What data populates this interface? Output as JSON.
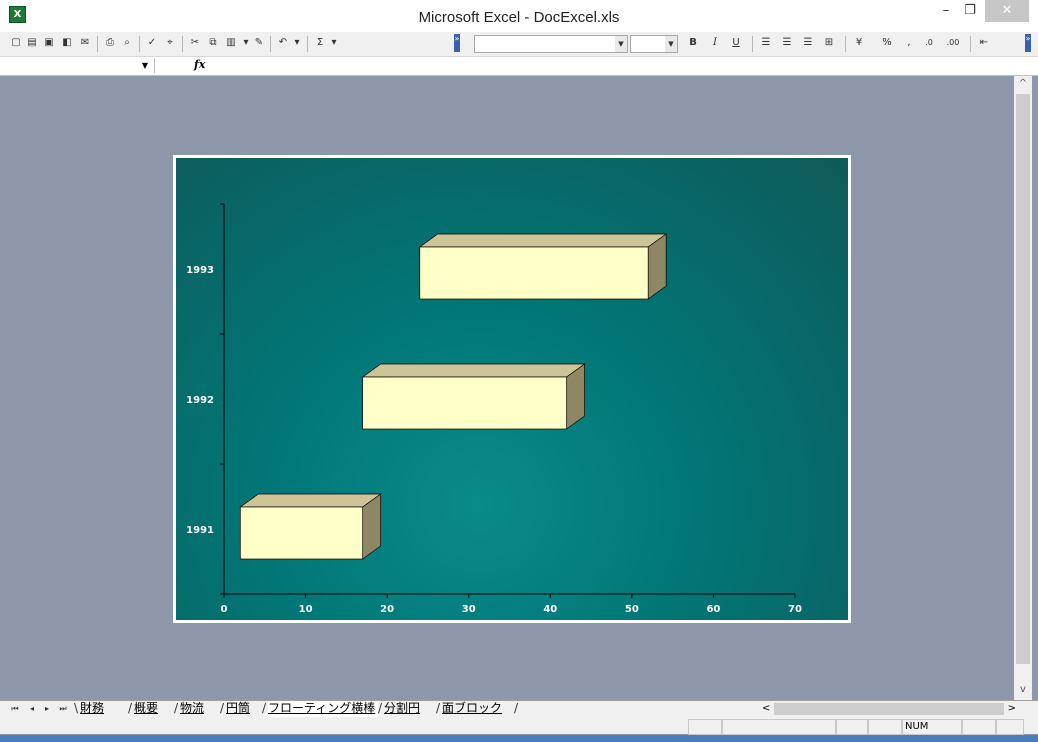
{
  "window": {
    "title": "Microsoft Excel - DocExcel.xls",
    "app_icon": "X"
  },
  "formula_bar": {
    "fx_label": "fx",
    "name_box": "",
    "formula": ""
  },
  "sheets": [
    {
      "label": "財務",
      "active": false
    },
    {
      "label": "概要",
      "active": false
    },
    {
      "label": "物流",
      "active": false
    },
    {
      "label": "円筒",
      "active": false
    },
    {
      "label": "フローティング横棒",
      "active": true
    },
    {
      "label": "分割円",
      "active": false
    },
    {
      "label": "面ブロック",
      "active": false
    }
  ],
  "status": {
    "num": "NUM"
  },
  "chart_data": {
    "type": "bar",
    "orientation": "horizontal",
    "style": "3d-floating",
    "categories": [
      "1991",
      "1992",
      "1993"
    ],
    "series": [
      {
        "values": [
          {
            "start": 2,
            "end": 17
          },
          {
            "start": 17,
            "end": 42
          },
          {
            "start": 24,
            "end": 52
          }
        ]
      }
    ],
    "xlim": [
      0,
      70
    ],
    "x_ticks": [
      "0",
      "10",
      "20",
      "30",
      "40",
      "50",
      "60",
      "70"
    ],
    "grid": false,
    "colors": {
      "bar_front": "#ffffc8",
      "bar_top": "#cdc597",
      "bar_side": "#8f8763",
      "background": "#017777",
      "axis_text": "#ffffff"
    }
  }
}
